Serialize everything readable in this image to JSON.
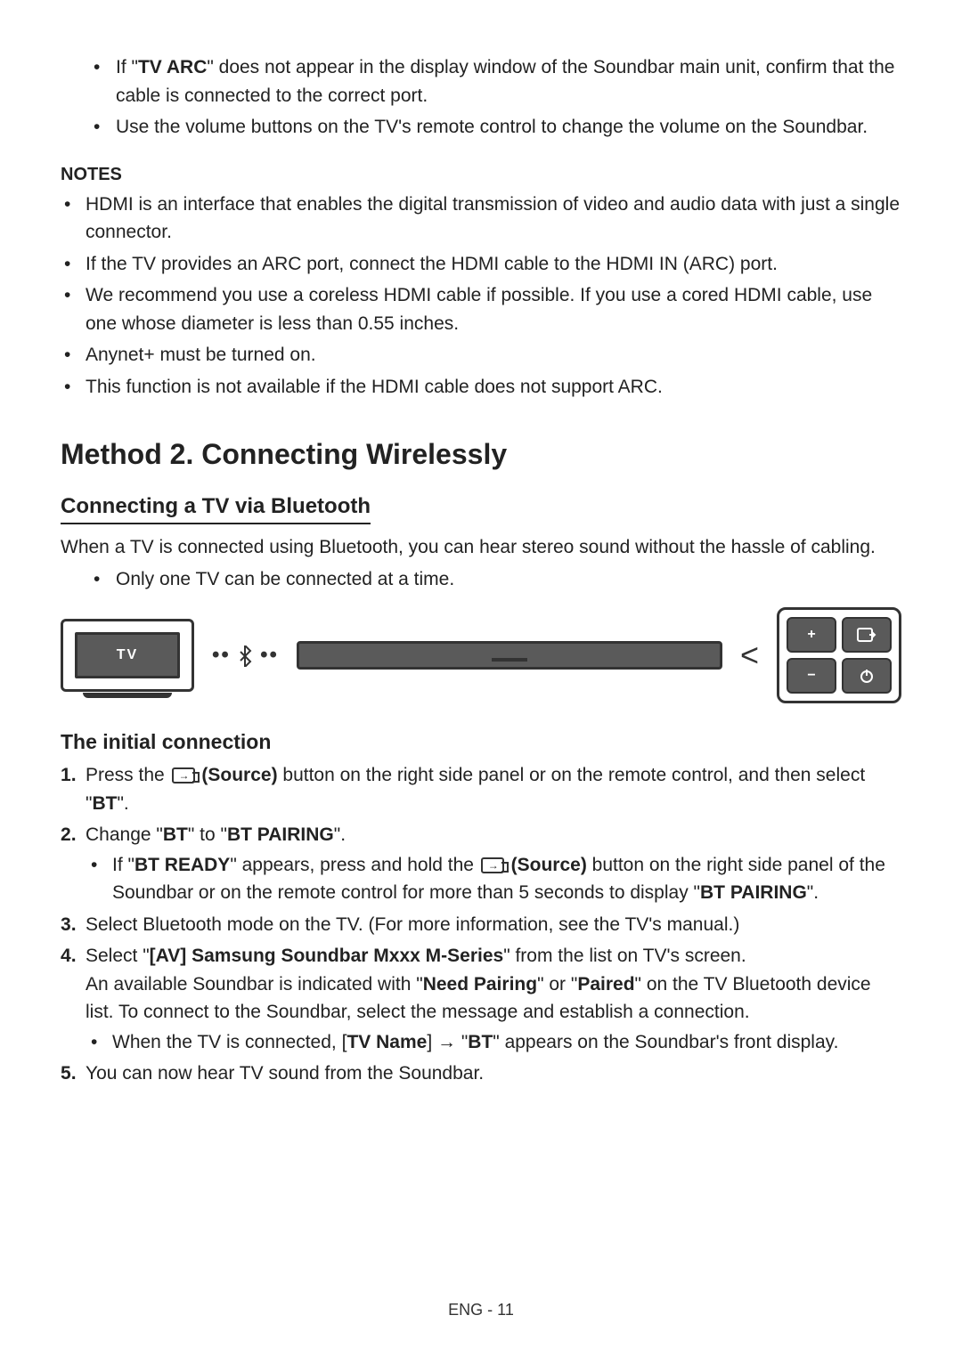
{
  "top_bullets": {
    "b1_pre": " If \"",
    "b1_bold": "TV ARC",
    "b1_post": "\" does not appear in the display window of the Soundbar main unit, confirm that the cable is connected to the correct port.",
    "b2": " Use the volume buttons on the TV's remote control to change the volume on the Soundbar."
  },
  "notes_heading": "NOTES",
  "notes": {
    "n1": " HDMI is an interface that enables the digital transmission of video and audio data with just a single connector.",
    "n2": " If the TV provides an ARC port, connect the HDMI cable to the HDMI IN (ARC) port.",
    "n3": " We recommend you use a coreless HDMI cable if possible. If you use a cored HDMI cable, use one whose diameter is less than 0.55 inches.",
    "n4": " Anynet+ must be turned on.",
    "n5": " This function is not available if the HDMI cable does not support ARC."
  },
  "method_heading": "Method 2. Connecting Wirelessly",
  "bt_heading": "Connecting a TV via Bluetooth",
  "bt_intro": "When a TV is connected using Bluetooth, you can hear stereo sound without the hassle of cabling.",
  "bt_bullet": " Only one TV can be connected at a time.",
  "diagram": {
    "tv_label": "TV",
    "bt_label": "••✻••"
  },
  "initial_heading": "The initial connection",
  "steps": {
    "s1_pre": "Press the ",
    "s1_bold": " (Source)",
    "s1_post": " button on the right side panel or on the remote control, and then select \"",
    "s1_bt": "BT",
    "s1_end": "\".",
    "s2_pre": "Change \"",
    "s2_bt": "BT",
    "s2_mid": "\" to \"",
    "s2_pair": "BT PAIRING",
    "s2_end": "\".",
    "s2_sub_pre": " If \"",
    "s2_sub_ready": "BT READY",
    "s2_sub_mid": "\" appears, press and hold the ",
    "s2_sub_src": " (Source)",
    "s2_sub_post": " button on the right side panel of the Soundbar or on the remote control for more than 5 seconds to display \"",
    "s2_sub_pair": "BT PAIRING",
    "s2_sub_end": "\".",
    "s3": "Select Bluetooth mode on the TV. (For more information, see the TV's manual.)",
    "s4_pre": "Select \"",
    "s4_bold": "[AV] Samsung Soundbar Mxxx M-Series",
    "s4_post": "\" from the list on TV's screen.",
    "s4_line2_pre": "An available Soundbar is indicated with \"",
    "s4_need": "Need Pairing",
    "s4_or": "\" or \"",
    "s4_paired": "Paired",
    "s4_line2_post": "\" on the TV Bluetooth device list. To connect to the Soundbar, select the message and establish a connection.",
    "s4_sub_pre": " When the TV is connected, [",
    "s4_sub_tvname": "TV Name",
    "s4_sub_arrow": "] → \"",
    "s4_sub_bt": "BT",
    "s4_sub_end": "\" appears on the Soundbar's front display.",
    "s5": "You can now hear TV sound from the Soundbar."
  },
  "footer": "ENG - 11"
}
